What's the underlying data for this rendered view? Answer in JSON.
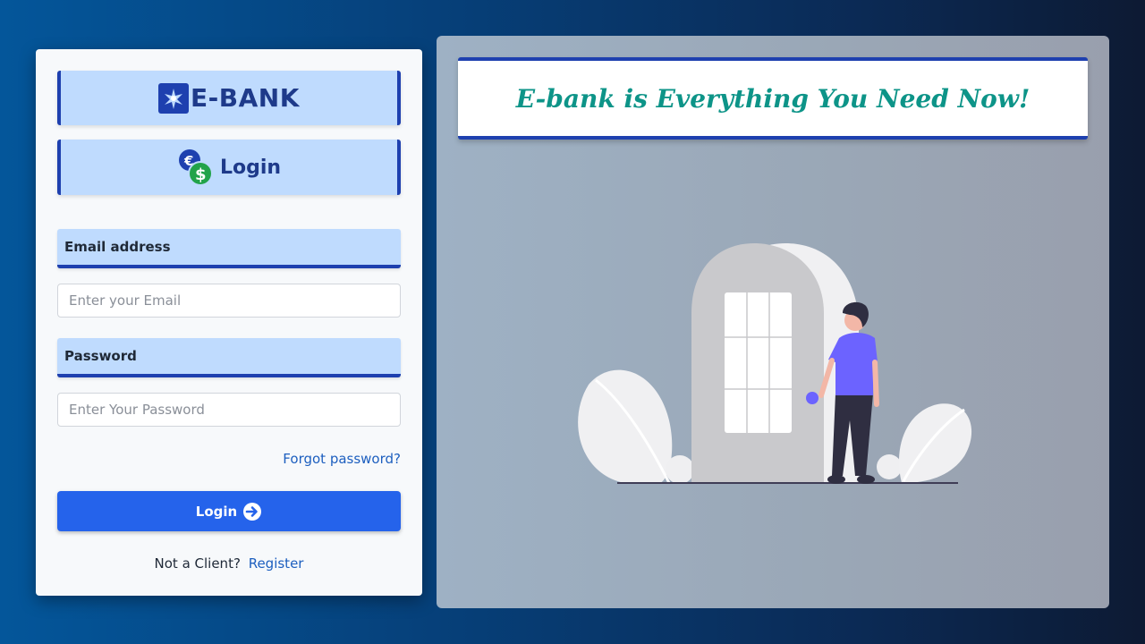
{
  "brand": {
    "name": "E-BANK",
    "logo_icon": "ebank-logo-icon"
  },
  "login_header": {
    "title": "Login",
    "icon": "currency-coins-icon"
  },
  "form": {
    "email_label": "Email address",
    "email_placeholder": "Enter your Email",
    "password_label": "Password",
    "password_placeholder": "Enter Your Password",
    "forgot_link": "Forgot password?",
    "login_button": "Login",
    "login_icon": "arrow-right-circle-icon",
    "register_prompt": "Not a Client?",
    "register_link": "Register"
  },
  "promo": {
    "headline": "E-bank is Everything You Need Now!",
    "illustration": "person-at-door-illustration"
  },
  "colors": {
    "accent": "#1e40af",
    "label_bg": "#bfdbfe",
    "button": "#2563eb",
    "headline": "#0d9488",
    "link": "#1d5fbf"
  }
}
